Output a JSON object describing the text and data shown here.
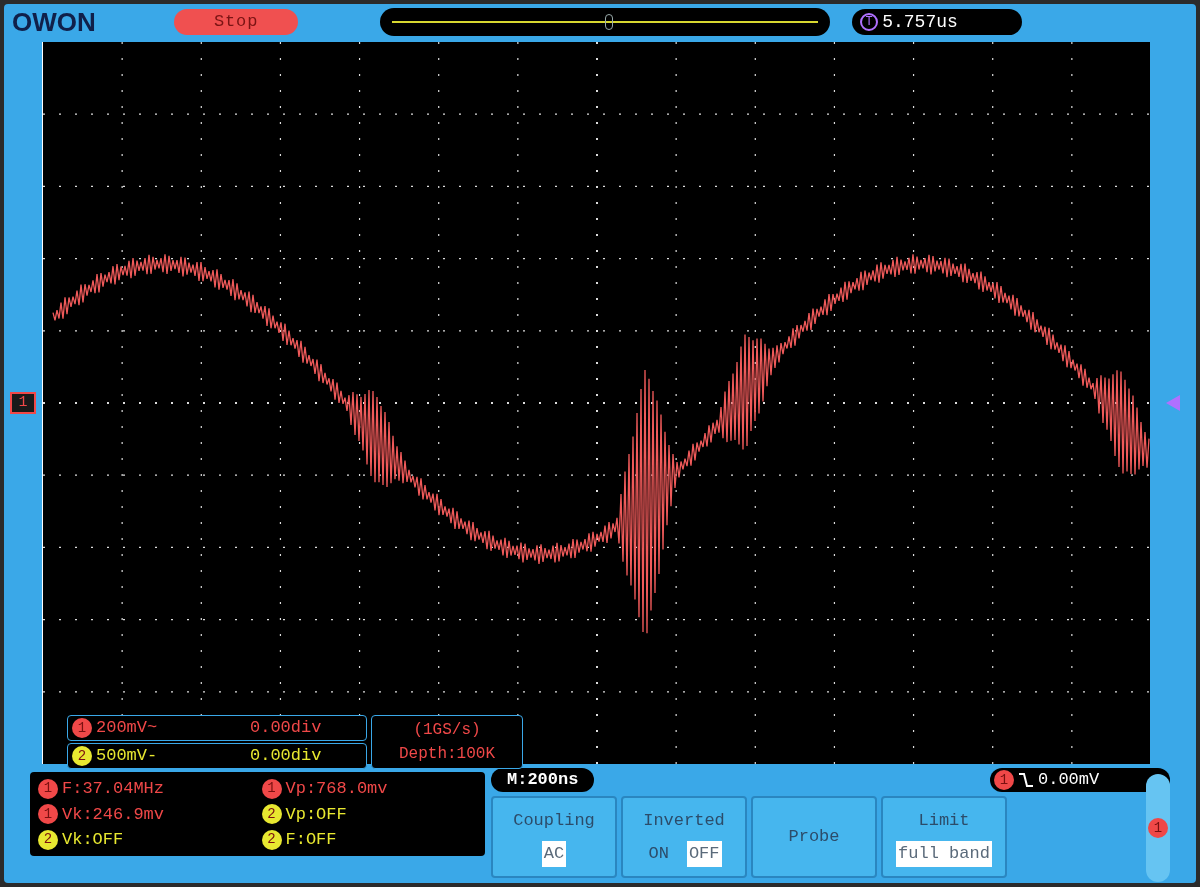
{
  "logo": "OWON",
  "run_state": "Stop",
  "trigger_badge": "T",
  "trigger_time": "5.757us",
  "channel_marker": "1",
  "channels": [
    {
      "badge": "1",
      "color": "#f04848",
      "scale": "200mV~",
      "offset": "0.00div"
    },
    {
      "badge": "2",
      "color": "#e8e830",
      "scale": "500mV-",
      "offset": "0.00div"
    }
  ],
  "sampling": {
    "rate": "(1GS/s)",
    "depth": "Depth:100K"
  },
  "measurements": [
    {
      "badge": "1",
      "color": "#f04848",
      "text": "F:37.04MHz"
    },
    {
      "badge": "1",
      "color": "#f04848",
      "text": "Vp:768.0mv"
    },
    {
      "badge": "1",
      "color": "#f04848",
      "text": "Vk:246.9mv"
    },
    {
      "badge": "2",
      "color": "#e8e830",
      "text": "Vp:OFF"
    },
    {
      "badge": "2",
      "color": "#e8e830",
      "text": "Vk:OFF"
    },
    {
      "badge": "2",
      "color": "#e8e830",
      "text": "F:OFF"
    }
  ],
  "timebase": "M:200ns",
  "trigger": {
    "badge": "1",
    "level": "0.00mV"
  },
  "menu": [
    {
      "title": "Coupling",
      "options": [
        {
          "label": "AC",
          "selected": true
        }
      ]
    },
    {
      "title": "Inverted",
      "options": [
        {
          "label": "ON",
          "selected": false
        },
        {
          "label": "OFF",
          "selected": true
        }
      ]
    },
    {
      "title": "Probe"
    },
    {
      "title": "Limit",
      "options": [
        {
          "label": "full band",
          "selected": true
        }
      ]
    }
  ],
  "side_tab": "1"
}
